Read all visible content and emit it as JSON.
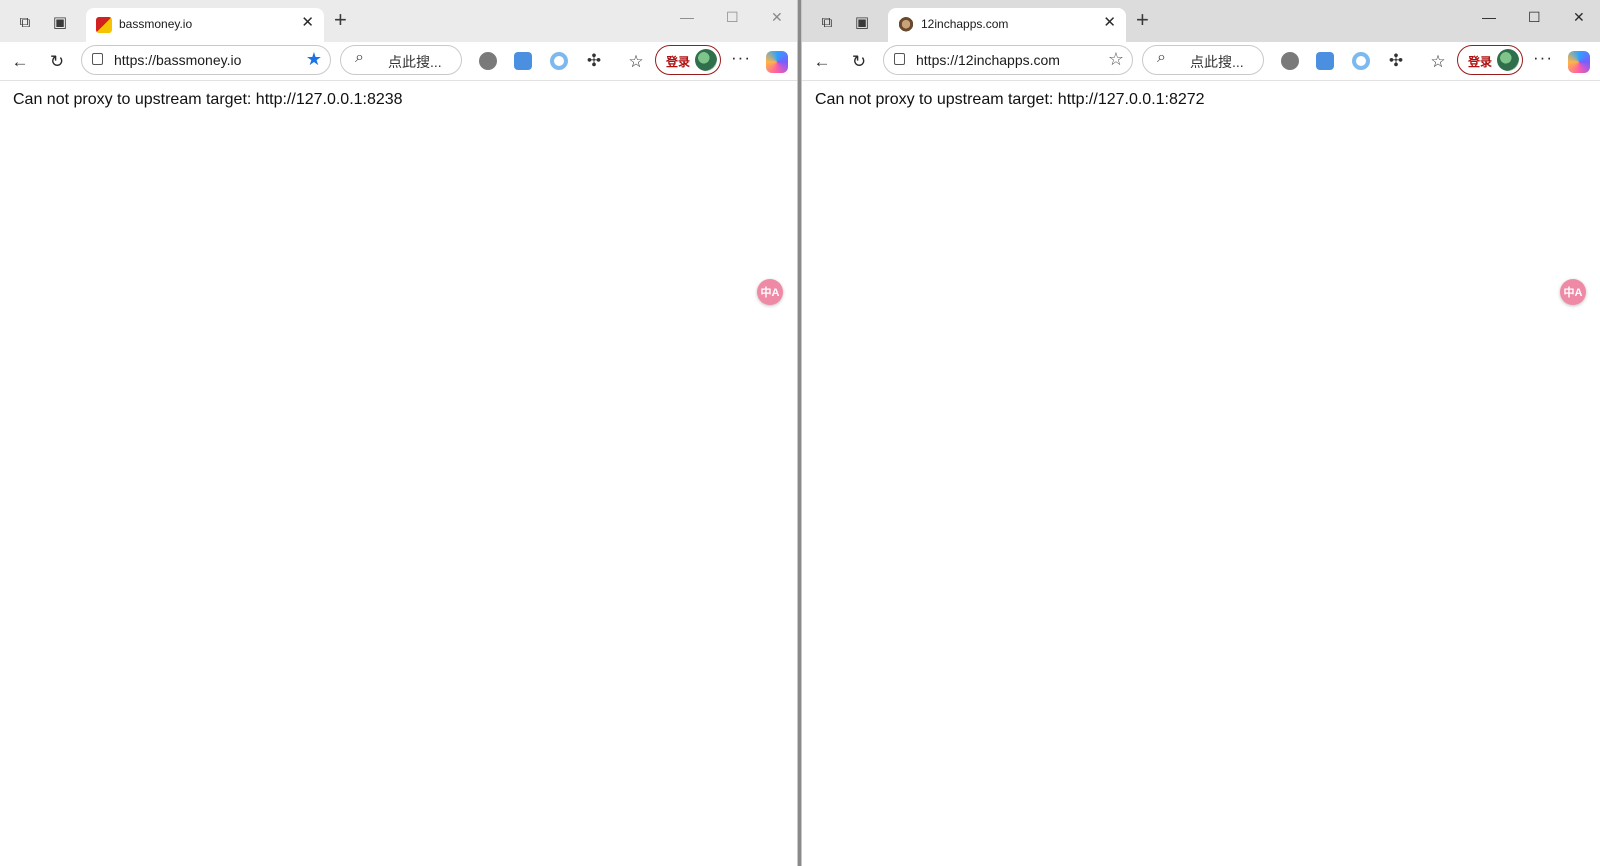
{
  "windows": [
    {
      "tab": {
        "title": "bassmoney.io"
      },
      "address": {
        "url": "https://bassmoney.io",
        "starred": true
      },
      "search": {
        "placeholder": "点此搜..."
      },
      "login": {
        "label": "登录"
      },
      "content": {
        "message": "Can not proxy to upstream target: http://127.0.0.1:8238"
      },
      "translate": {
        "label": "中A"
      }
    },
    {
      "tab": {
        "title": "12inchapps.com"
      },
      "address": {
        "url": "https://12inchapps.com",
        "starred": false
      },
      "search": {
        "placeholder": "点此搜..."
      },
      "login": {
        "label": "登录"
      },
      "content": {
        "message": "Can not proxy to upstream target: http://127.0.0.1:8272"
      },
      "translate": {
        "label": "中A"
      }
    }
  ],
  "icons": {
    "workspaces": "⧉",
    "tab_actions": "▣",
    "close": "✕",
    "new_tab": "+",
    "minimize": "—",
    "maximize": "☐",
    "back": "←",
    "refresh": "↻",
    "star_filled": "★",
    "star_outline": "☆",
    "search": "⌕",
    "extensions": "✣",
    "favorites": "☆",
    "more": "···"
  },
  "colors": {
    "star_active": "#1a73e8",
    "login_border": "#9b1b1b",
    "login_text": "#b01010",
    "translate_bg": "#ef8aa6"
  }
}
